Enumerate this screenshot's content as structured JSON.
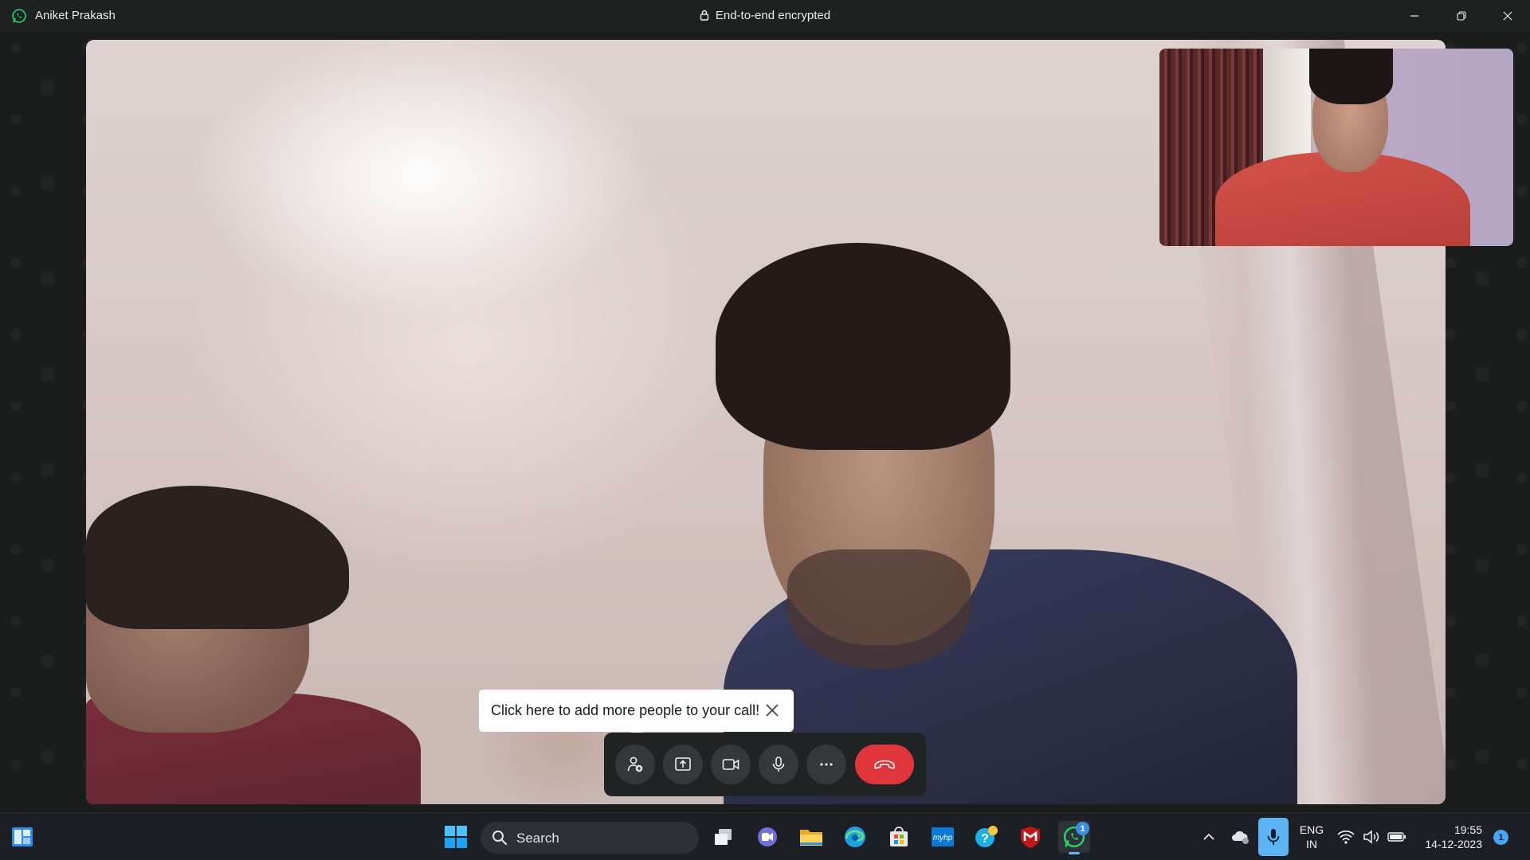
{
  "window": {
    "contact_name": "Aniket Prakash",
    "encryption_label": "End-to-end encrypted"
  },
  "call": {
    "tooltip_text": "Click here to add more people to your call!",
    "controls": [
      {
        "name": "add-people",
        "icon": "add-person-icon"
      },
      {
        "name": "share-screen",
        "icon": "share-screen-icon"
      },
      {
        "name": "camera",
        "icon": "video-camera-icon"
      },
      {
        "name": "microphone",
        "icon": "microphone-icon"
      },
      {
        "name": "more-options",
        "icon": "more-horizontal-icon"
      },
      {
        "name": "end-call",
        "icon": "hang-up-icon"
      }
    ],
    "end_call_color": "#e0353b"
  },
  "taskbar": {
    "search_label": "Search",
    "whatsapp_badge": "1",
    "language_line1": "ENG",
    "language_line2": "IN",
    "time": "19:55",
    "date": "14-12-2023",
    "notification_count": "1"
  }
}
